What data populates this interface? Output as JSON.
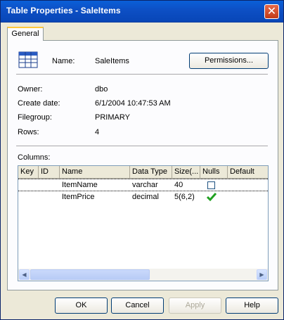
{
  "window": {
    "title": "Table Properties - SaleItems"
  },
  "tabs": [
    {
      "label": "General"
    }
  ],
  "header": {
    "name_label": "Name:",
    "name_value": "SaleItems",
    "permissions_button": "Permissions..."
  },
  "properties": [
    {
      "label": "Owner:",
      "value": "dbo"
    },
    {
      "label": "Create date:",
      "value": "6/1/2004 10:47:53 AM"
    },
    {
      "label": "Filegroup:",
      "value": "PRIMARY"
    },
    {
      "label": "Rows:",
      "value": "4"
    }
  ],
  "columns": {
    "label": "Columns:",
    "headers": [
      "Key",
      "ID",
      "Name",
      "Data Type",
      "Size(...",
      "Nulls",
      "Default"
    ],
    "rows": [
      {
        "key": "",
        "id": "",
        "name": "ItemName",
        "data_type": "varchar",
        "size": "40",
        "nulls": false,
        "default": ""
      },
      {
        "key": "",
        "id": "",
        "name": "ItemPrice",
        "data_type": "decimal",
        "size": "5(6,2)",
        "nulls": true,
        "default": ""
      }
    ]
  },
  "buttons": {
    "ok": "OK",
    "cancel": "Cancel",
    "apply": "Apply",
    "help": "Help"
  },
  "icons": {
    "close": "close-icon",
    "table": "table-icon",
    "check": "checkmark-icon"
  },
  "colors": {
    "titlebar": "#0a5fd8",
    "check": "#21a121"
  }
}
